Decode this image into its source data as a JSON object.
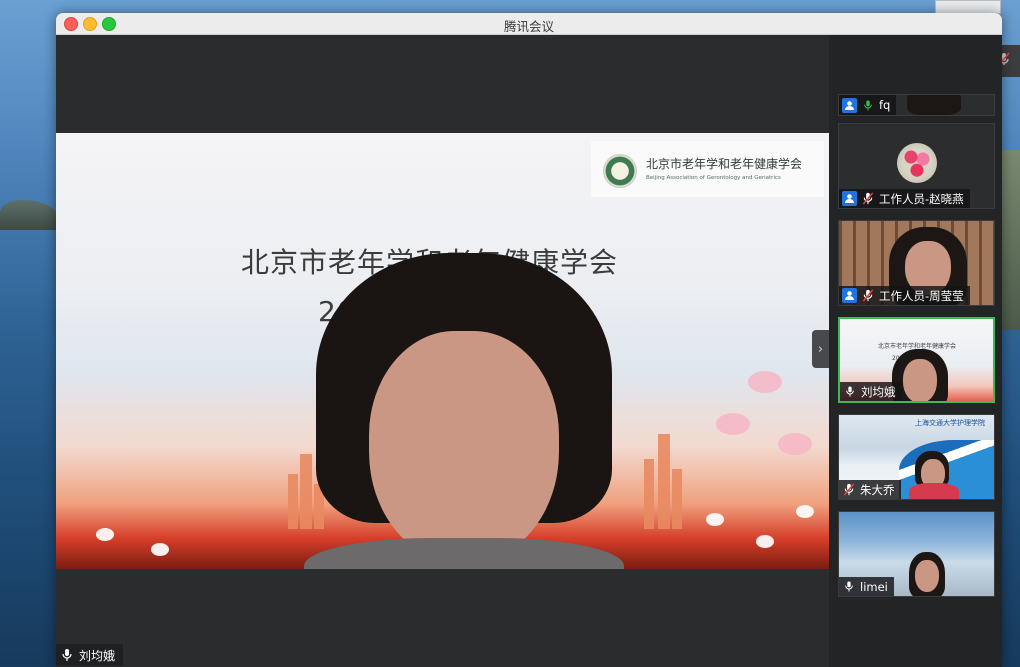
{
  "window": {
    "title": "腾讯会议"
  },
  "main_video": {
    "speaker_name": "刘均娥",
    "shared_slide": {
      "logo_cn": "北京市老年学和老年健康学会",
      "logo_en": "Beijing Association of Gerontology and Geriatrics",
      "title_line1": "北京市老年学和老年健康学会",
      "title_line2": "20"
    }
  },
  "participants": [
    {
      "name": "fq",
      "mic": "on",
      "icon": "person-icon"
    },
    {
      "name": "工作人员-赵晓燕",
      "mic": "muted",
      "icon": "person-icon"
    },
    {
      "name": "工作人员-周莹莹",
      "mic": "muted",
      "icon": "person-icon"
    },
    {
      "name": "刘均娥",
      "mic": "on",
      "active": true
    },
    {
      "name": "朱大乔",
      "mic": "muted"
    },
    {
      "name": "limei",
      "mic": "on"
    }
  ],
  "mini_slide": {
    "title": "北京市老年学和老年健康学会",
    "sub": "20"
  },
  "mini_ship": {
    "title": "上海交通大学护理学院"
  },
  "colors": {
    "active_border": "#3dbb52",
    "person_icon": "#1f74e0",
    "muted_red": "#e2463f"
  },
  "icons": {
    "collapse": "chevron-right-icon",
    "side_mute": "mic-off-icon"
  }
}
